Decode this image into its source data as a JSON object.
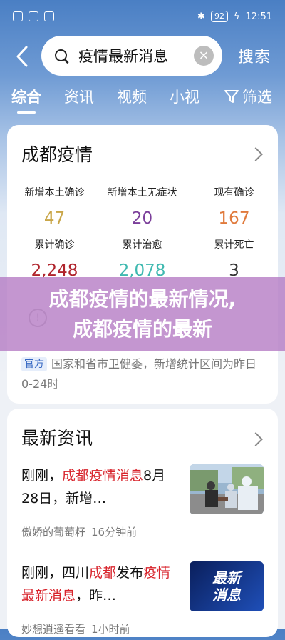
{
  "status_bar": {
    "battery": "92",
    "time": "12:51"
  },
  "header": {
    "search_value": "疫情最新消息",
    "search_button": "搜索"
  },
  "tabs": [
    {
      "label": "综合"
    },
    {
      "label": "资讯"
    },
    {
      "label": "视频"
    },
    {
      "label": "小视"
    }
  ],
  "filter_label": "筛选",
  "epidemic_card": {
    "title": "成都疫情",
    "stats": [
      {
        "label": "新增本土确诊",
        "value": "47",
        "color": "#c9a648"
      },
      {
        "label": "新增本土无症状",
        "value": "20",
        "color": "#7b3f9a"
      },
      {
        "label": "现有确诊",
        "value": "167",
        "color": "#e07a3c"
      },
      {
        "label": "累计确诊",
        "value": "2,248",
        "color": "#b0242c"
      },
      {
        "label": "累计治愈",
        "value": "2,078",
        "color": "#3fb9b0"
      },
      {
        "label": "累计死亡",
        "value": "3",
        "color": "#333333"
      }
    ],
    "source_tag": "官方",
    "note": "国家和省市卫健委，新增统计区间为昨日0-24时"
  },
  "banner": {
    "text": "成都疫情的最新情况,成都疫情的最新"
  },
  "news_card": {
    "title": "最新资讯",
    "items": [
      {
        "title_before": "刚刚，",
        "title_highlight": "成都疫情消息",
        "title_after": "8月28日，新增…",
        "source": "傲娇的葡萄籽",
        "time": "16分钟前"
      },
      {
        "title_before": "刚刚，四川",
        "title_highlight": "成都",
        "title_mid": "发布",
        "title_highlight2": "疫情最新消息",
        "title_after": "，昨…",
        "source": "妙想逍遥看看",
        "time": "1小时前",
        "thumb_text_1": "最新",
        "thumb_text_2": "消息"
      }
    ]
  }
}
